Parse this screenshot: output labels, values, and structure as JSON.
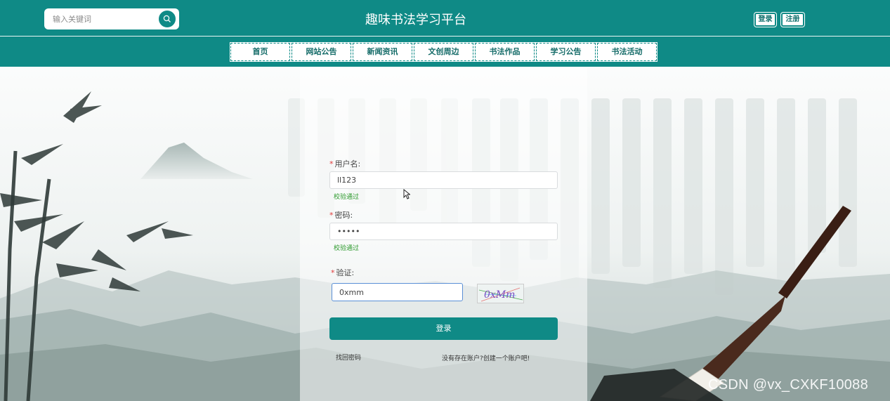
{
  "header": {
    "title": "趣味书法学习平台",
    "search": {
      "placeholder": "输入关键词",
      "value": ""
    },
    "login_label": "登录",
    "register_label": "注册"
  },
  "nav": {
    "items": [
      {
        "label": "首页"
      },
      {
        "label": "网站公告"
      },
      {
        "label": "新闻资讯"
      },
      {
        "label": "文创周边"
      },
      {
        "label": "书法作品"
      },
      {
        "label": "学习公告"
      },
      {
        "label": "书法活动"
      }
    ]
  },
  "form": {
    "username": {
      "label": "用户名:",
      "value": "ll123",
      "status": "校验通过"
    },
    "password": {
      "label": "密码:",
      "value": "•••••",
      "status": "校验通过"
    },
    "captcha": {
      "label": "验证:",
      "value": "0xmm",
      "image_text": "0xMm"
    },
    "required_mark": "*",
    "submit_label": "登录",
    "forgot_label": "找回密码",
    "register_prompt": "没有存在账户?创建一个账户吧!"
  },
  "watermark": "CSDN @vx_CXKF10088",
  "colors": {
    "brand": "#0f8a86",
    "valid": "#2d9a2d",
    "required": "#e03a3a"
  }
}
